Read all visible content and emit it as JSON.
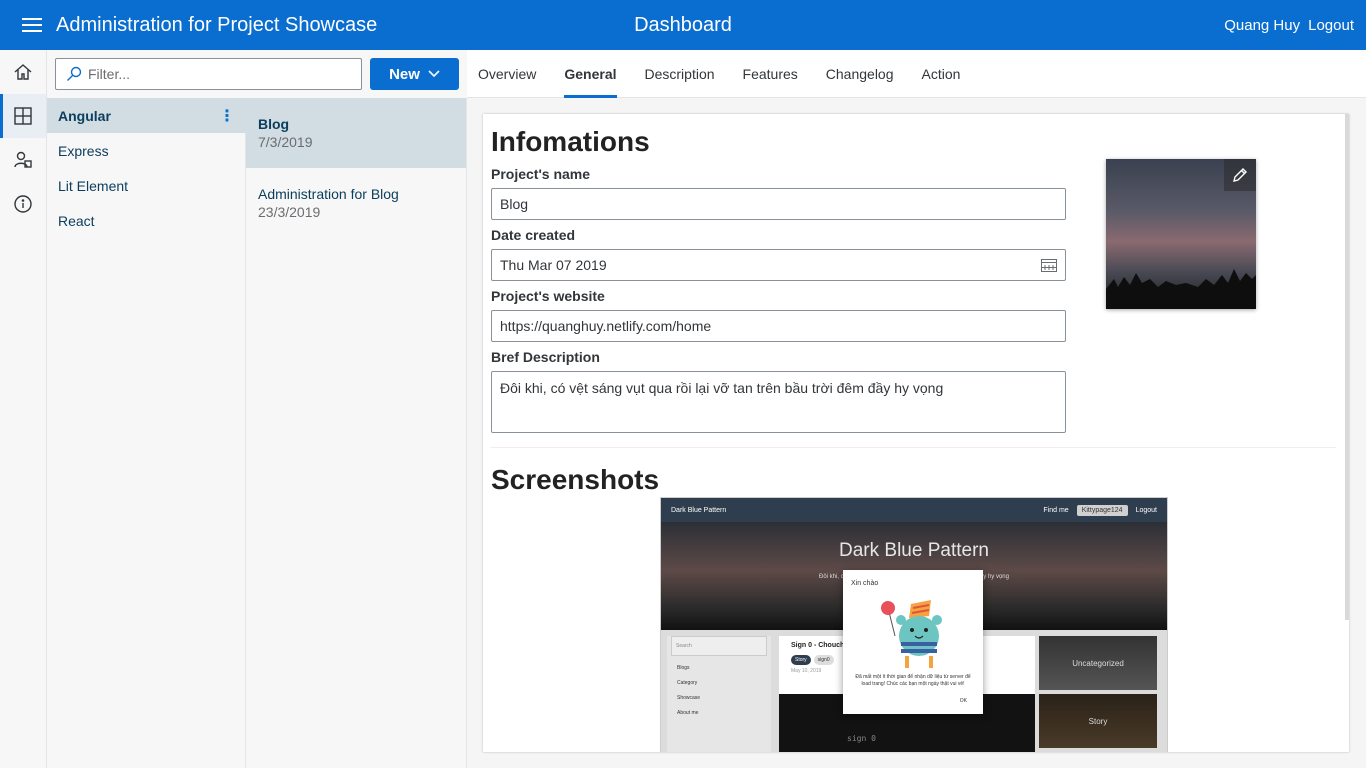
{
  "header": {
    "app_title": "Administration for Project Showcase",
    "page_title": "Dashboard",
    "user_name": "Quang Huy",
    "logout_label": "Logout"
  },
  "rail": {
    "items": [
      {
        "icon": "home-icon"
      },
      {
        "icon": "dashboard-icon",
        "active": true
      },
      {
        "icon": "user-group-icon"
      },
      {
        "icon": "info-icon"
      }
    ]
  },
  "toolbar": {
    "filter_placeholder": "Filter...",
    "new_label": "New"
  },
  "projects": [
    {
      "label": "Angular"
    },
    {
      "label": "Express"
    },
    {
      "label": "Lit Element"
    },
    {
      "label": "React"
    }
  ],
  "blogs": [
    {
      "title": "Blog",
      "date": "7/3/2019"
    },
    {
      "title": "Administration for Blog",
      "date": "23/3/2019"
    }
  ],
  "tabs": [
    {
      "label": "Overview"
    },
    {
      "label": "General"
    },
    {
      "label": "Description"
    },
    {
      "label": "Features"
    },
    {
      "label": "Changelog"
    },
    {
      "label": "Action"
    }
  ],
  "info": {
    "section_title": "Infomations",
    "name_label": "Project's name",
    "name_value": "Blog",
    "date_label": "Date created",
    "date_value": "Thu Mar 07 2019",
    "website_label": "Project's website",
    "website_value": "https://quanghuy.netlify.com/home",
    "desc_label": "Bref Description",
    "desc_value": "Đôi khi, có vệt sáng vụt qua rồi lại vỡ tan trên bầu trời đêm đầy hy vọng"
  },
  "screenshots": {
    "section_title": "Screenshots",
    "mock": {
      "nav_brand": "Dark Blue Pattern",
      "nav_find": "Find me",
      "nav_user": "Kittypage124",
      "nav_logout": "Logout",
      "hero_title": "Dark Blue Pattern",
      "hero_sub": "Đôi khi, có vệt sáng vụt qua rồi lại vỡ tan trên bầu trời đêm đầy hy vọng",
      "search": "Search",
      "side_items": [
        "Blogs",
        "Category",
        "Showcase",
        "About me"
      ],
      "post_title": "Sign 0 - Chouch",
      "tag1": "Story",
      "tag2": "sign0",
      "post_date": "May 10, 2019",
      "code": "sign 0",
      "cat1": "Uncategorized",
      "cat2": "Story",
      "modal_title": "Xin chào",
      "modal_text": "Đã mất một ít thời gian để nhận dữ liệu từ server để load trang! Chúc các bạn một ngày thật vui vẻ!",
      "modal_ok": "OK"
    }
  },
  "colors": {
    "brand": "#0a6ed1",
    "selected_bg": "#d1dde3"
  }
}
